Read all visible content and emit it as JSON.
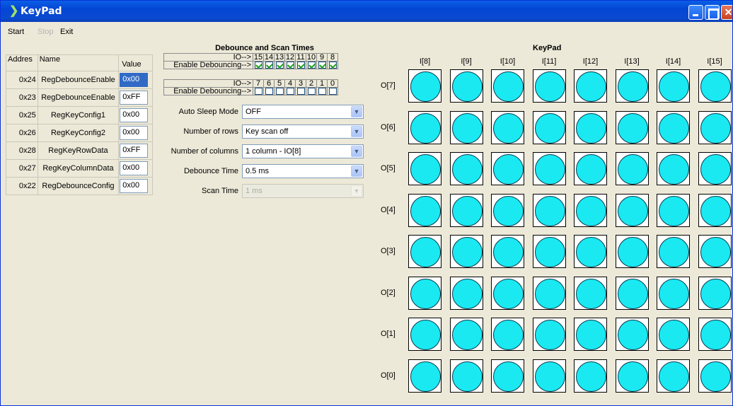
{
  "window": {
    "title": "KeyPad"
  },
  "menu": {
    "start": "Start",
    "stop": "Stop",
    "exit": "Exit"
  },
  "registers": {
    "headers": {
      "addr": "Addres",
      "name": "Name",
      "value": "Value"
    },
    "rows": [
      {
        "addr": "0x24",
        "name": "RegDebounceEnable",
        "value": "0x00"
      },
      {
        "addr": "0x23",
        "name": "RegDebounceEnable",
        "value": "0xFF"
      },
      {
        "addr": "0x25",
        "name": "RegKeyConfig1",
        "value": "0x00"
      },
      {
        "addr": "0x26",
        "name": "RegKeyConfig2",
        "value": "0x00"
      },
      {
        "addr": "0x28",
        "name": "RegKeyRowData",
        "value": "0xFF"
      },
      {
        "addr": "0x27",
        "name": "RegKeyColumnData",
        "value": "0x00"
      },
      {
        "addr": "0x22",
        "name": "RegDebounceConfig",
        "value": "0x00"
      }
    ]
  },
  "debounce": {
    "title": "Debounce and Scan Times",
    "io_label": "IO-->",
    "enable_label": "Enable Debouncing-->",
    "high_bits": [
      "15",
      "14",
      "13",
      "12",
      "11",
      "10",
      "9",
      "8"
    ],
    "low_bits": [
      "7",
      "6",
      "5",
      "4",
      "3",
      "2",
      "1",
      "0"
    ],
    "high_checked": [
      true,
      true,
      true,
      true,
      true,
      true,
      true,
      true
    ],
    "low_checked": [
      false,
      false,
      false,
      false,
      false,
      false,
      false,
      false
    ]
  },
  "settings": {
    "auto_sleep": {
      "label": "Auto Sleep Mode",
      "value": "OFF"
    },
    "rows": {
      "label": "Number of rows",
      "value": "Key scan off"
    },
    "cols": {
      "label": "Number of columns",
      "value": "1 column - IO[8]"
    },
    "debounce_time": {
      "label": "Debounce Time",
      "value": "0.5 ms"
    },
    "scan_time": {
      "label": "Scan Time",
      "value": "1 ms"
    }
  },
  "keypad": {
    "title": "KeyPad",
    "columns": [
      "I[8]",
      "I[9]",
      "I[10]",
      "I[11]",
      "I[12]",
      "I[13]",
      "I[14]",
      "I[15]"
    ],
    "rows": [
      "O[7]",
      "O[6]",
      "O[5]",
      "O[4]",
      "O[3]",
      "O[2]",
      "O[1]",
      "O[0]"
    ],
    "key_color": "#1ae9f2"
  },
  "colors": {
    "titlebar": "#0a4ad0",
    "face": "#ece9d8",
    "selection": "#316ac5"
  }
}
